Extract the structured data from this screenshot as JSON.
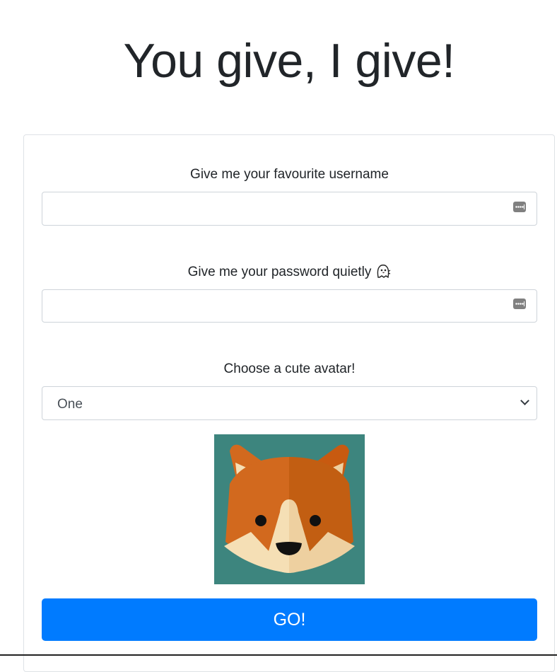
{
  "page": {
    "title": "You give, I give!"
  },
  "form": {
    "username_label": "Give me your favourite username",
    "username_value": "",
    "password_label": "Give me your password quietly",
    "password_value": "",
    "avatar_label": "Choose a cute avatar!",
    "avatar_selected": "One",
    "submit_label": "GO!"
  },
  "icons": {
    "password_manager": "password-manager-icon",
    "label_emoji": "ghost-emoji-icon",
    "select_arrow": "chevron-down-icon",
    "avatar": "fox-avatar"
  },
  "colors": {
    "primary": "#007bff",
    "avatar_background": "#3d857e",
    "fox_orange": "#d2691e",
    "fox_cream": "#f5dfb5"
  }
}
